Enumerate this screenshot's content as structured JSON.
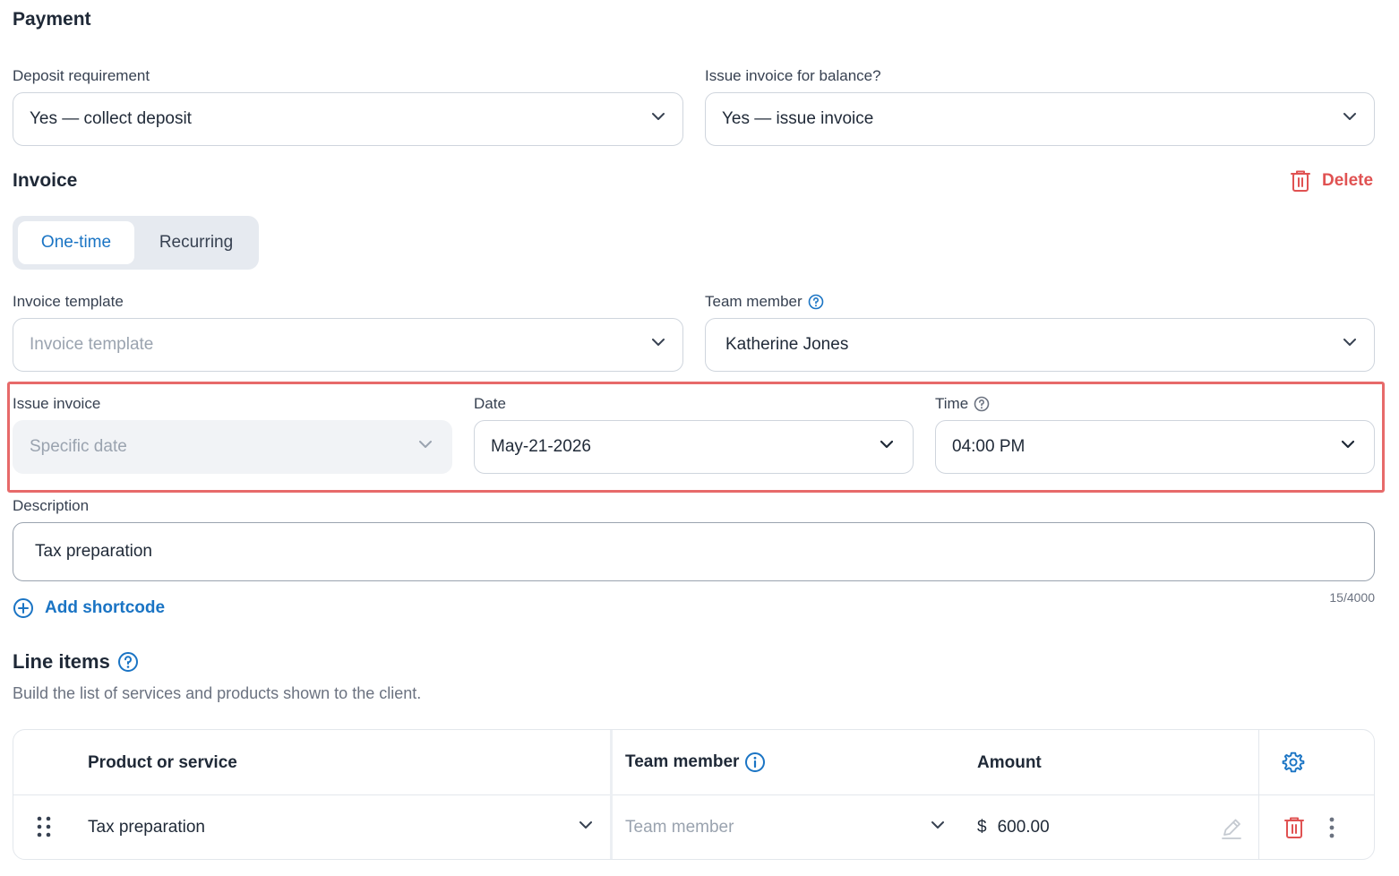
{
  "payment": {
    "title": "Payment",
    "deposit_label": "Deposit requirement",
    "deposit_value": "Yes — collect deposit",
    "balance_label": "Issue invoice for balance?",
    "balance_value": "Yes — issue invoice"
  },
  "invoice": {
    "title": "Invoice",
    "delete_label": "Delete",
    "tabs": [
      {
        "label": "One-time",
        "active": true
      },
      {
        "label": "Recurring",
        "active": false
      }
    ],
    "template_label": "Invoice template",
    "template_placeholder": "Invoice template",
    "team_member_label": "Team member",
    "team_member_value": "Katherine Jones",
    "issue_label": "Issue invoice",
    "issue_value": "Specific date",
    "date_label": "Date",
    "date_value": "May-21-2026",
    "time_label": "Time",
    "time_value": "04:00 PM",
    "description_label": "Description",
    "description_value": "Tax preparation",
    "description_counter": "15/4000",
    "add_shortcode_label": "Add shortcode"
  },
  "line_items": {
    "title": "Line items",
    "subtitle": "Build the list of services and products shown to the client.",
    "columns": {
      "product": "Product or service",
      "team_member": "Team member",
      "amount": "Amount"
    },
    "rows": [
      {
        "product": "Tax preparation",
        "team_member_placeholder": "Team member",
        "currency": "$",
        "amount": "600.00"
      }
    ]
  },
  "colors": {
    "accent": "#1a74c4",
    "danger": "#e05252",
    "highlight": "#e76a6a"
  }
}
